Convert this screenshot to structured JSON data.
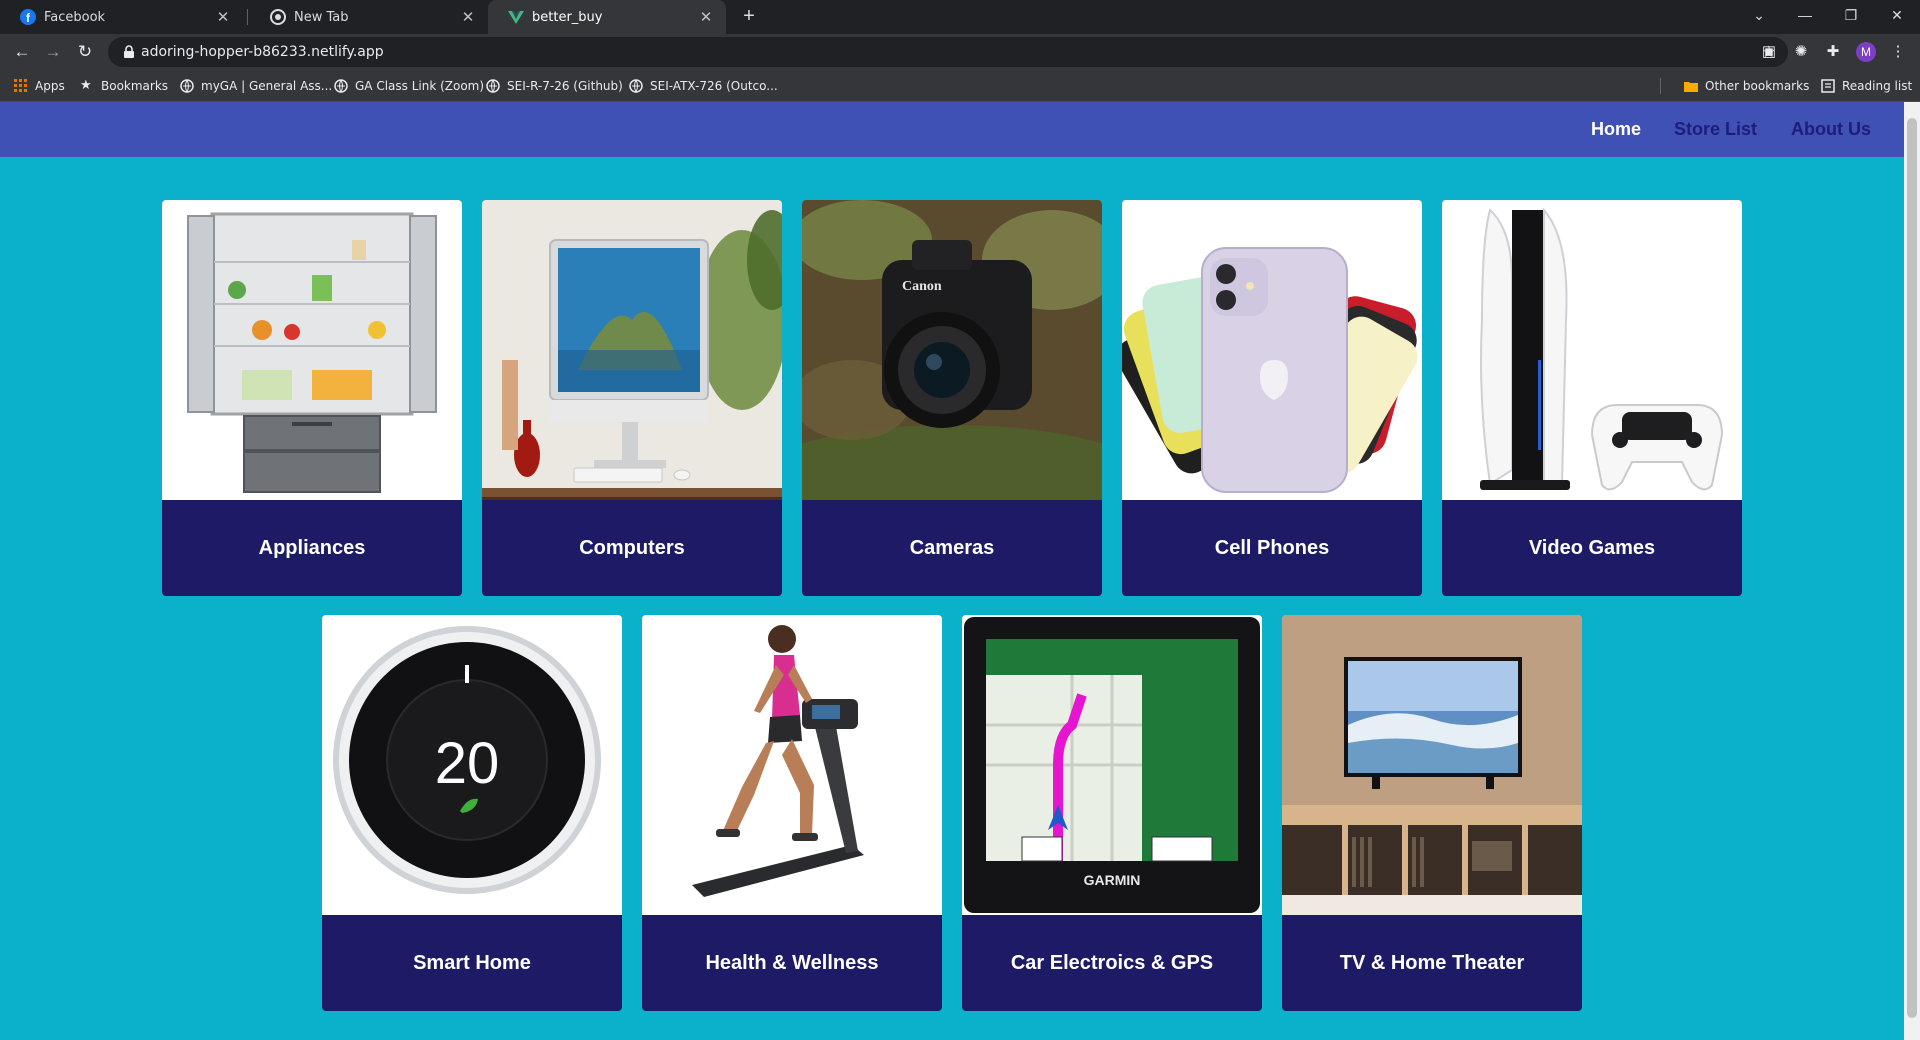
{
  "browser": {
    "tabs": [
      {
        "title": "Facebook",
        "icon": "facebook-icon"
      },
      {
        "title": "New Tab",
        "icon": "chrome-icon"
      },
      {
        "title": "better_buy",
        "icon": "vue-icon",
        "active": true
      }
    ],
    "url": "adoring-hopper-b86233.netlify.app",
    "avatar_letter": "M",
    "bookmarks": [
      {
        "label": "Apps",
        "icon": "apps-grid-icon"
      },
      {
        "label": "Bookmarks",
        "icon": "star-icon"
      },
      {
        "label": "myGA | General Ass...",
        "icon": "globe-icon"
      },
      {
        "label": "GA Class Link (Zoom)",
        "icon": "globe-icon"
      },
      {
        "label": "SEI-R-7-26 (Github)",
        "icon": "globe-icon"
      },
      {
        "label": "SEI-ATX-726 (Outco...",
        "icon": "globe-icon"
      }
    ],
    "other_bookmarks": "Other bookmarks",
    "reading_list": "Reading list"
  },
  "site": {
    "nav": {
      "home": "Home",
      "store_list": "Store List",
      "about_us": "About Us"
    },
    "categories": [
      {
        "label": "Appliances",
        "image": "refrigerator"
      },
      {
        "label": "Computers",
        "image": "desktop-computer"
      },
      {
        "label": "Cameras",
        "image": "dslr-camera"
      },
      {
        "label": "Cell Phones",
        "image": "smartphones"
      },
      {
        "label": "Video Games",
        "image": "game-console"
      },
      {
        "label": "Smart Home",
        "image": "thermostat",
        "display_value": "20"
      },
      {
        "label": "Health & Wellness",
        "image": "treadmill"
      },
      {
        "label": "Car Electroics & GPS",
        "image": "gps-navigator"
      },
      {
        "label": "TV & Home Theater",
        "image": "television"
      }
    ]
  },
  "colors": {
    "page_bg": "#0bb0cb",
    "nav_bg": "#3f51b5",
    "card_label_bg": "#1e1b66",
    "nav_link": "#1f1d7a",
    "nav_active": "#ffffff"
  }
}
